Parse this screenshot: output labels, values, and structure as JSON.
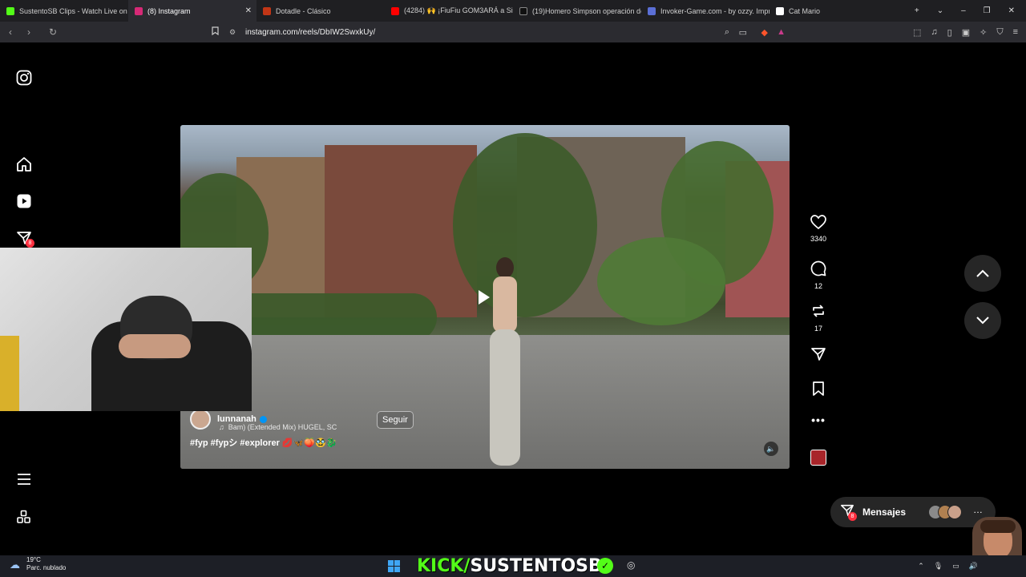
{
  "browser": {
    "tabs": [
      {
        "label": "SustentoSB Clips - Watch Live on K",
        "color": "#53fc18",
        "active": false
      },
      {
        "label": "(8) Instagram",
        "color": "#d62976",
        "active": true
      },
      {
        "label": "Dotadle - Clásico",
        "color": "#c23616",
        "active": false
      },
      {
        "label": "(4284) 🙌 ¡FiuFiu GOM3ARÁ a Side",
        "color": "#ff0000",
        "active": false
      },
      {
        "label": "(19)Homero Simpson operación de",
        "color": "#111111",
        "active": false
      },
      {
        "label": "Invoker-Game.com - by ozzy. Impro",
        "color": "#5b6fd6",
        "active": false
      },
      {
        "label": "Cat Mario",
        "color": "#ffffff",
        "active": false
      }
    ],
    "url": "instagram.com/reels/DbIW2SwxkUy/"
  },
  "reel": {
    "username": "lunnanah",
    "song": "Bam) (Extended Mix)  HUGEL, SC",
    "follow_label": "Seguir",
    "hashtags": "#fyp #fypシ #explorer 💋🦋🍑🥸🐉",
    "likes": "3340",
    "comments": "12",
    "reposts": "17"
  },
  "messages": {
    "label": "Mensajes",
    "badge": "8"
  },
  "sidebar": {
    "notif_badge": "8"
  },
  "overlay": {
    "kick_prefix": "KICK/",
    "kick_channel": "SUSTENTOSB"
  },
  "taskbar": {
    "weather_temp": "19°C",
    "weather_desc": "Parc. nublado"
  }
}
